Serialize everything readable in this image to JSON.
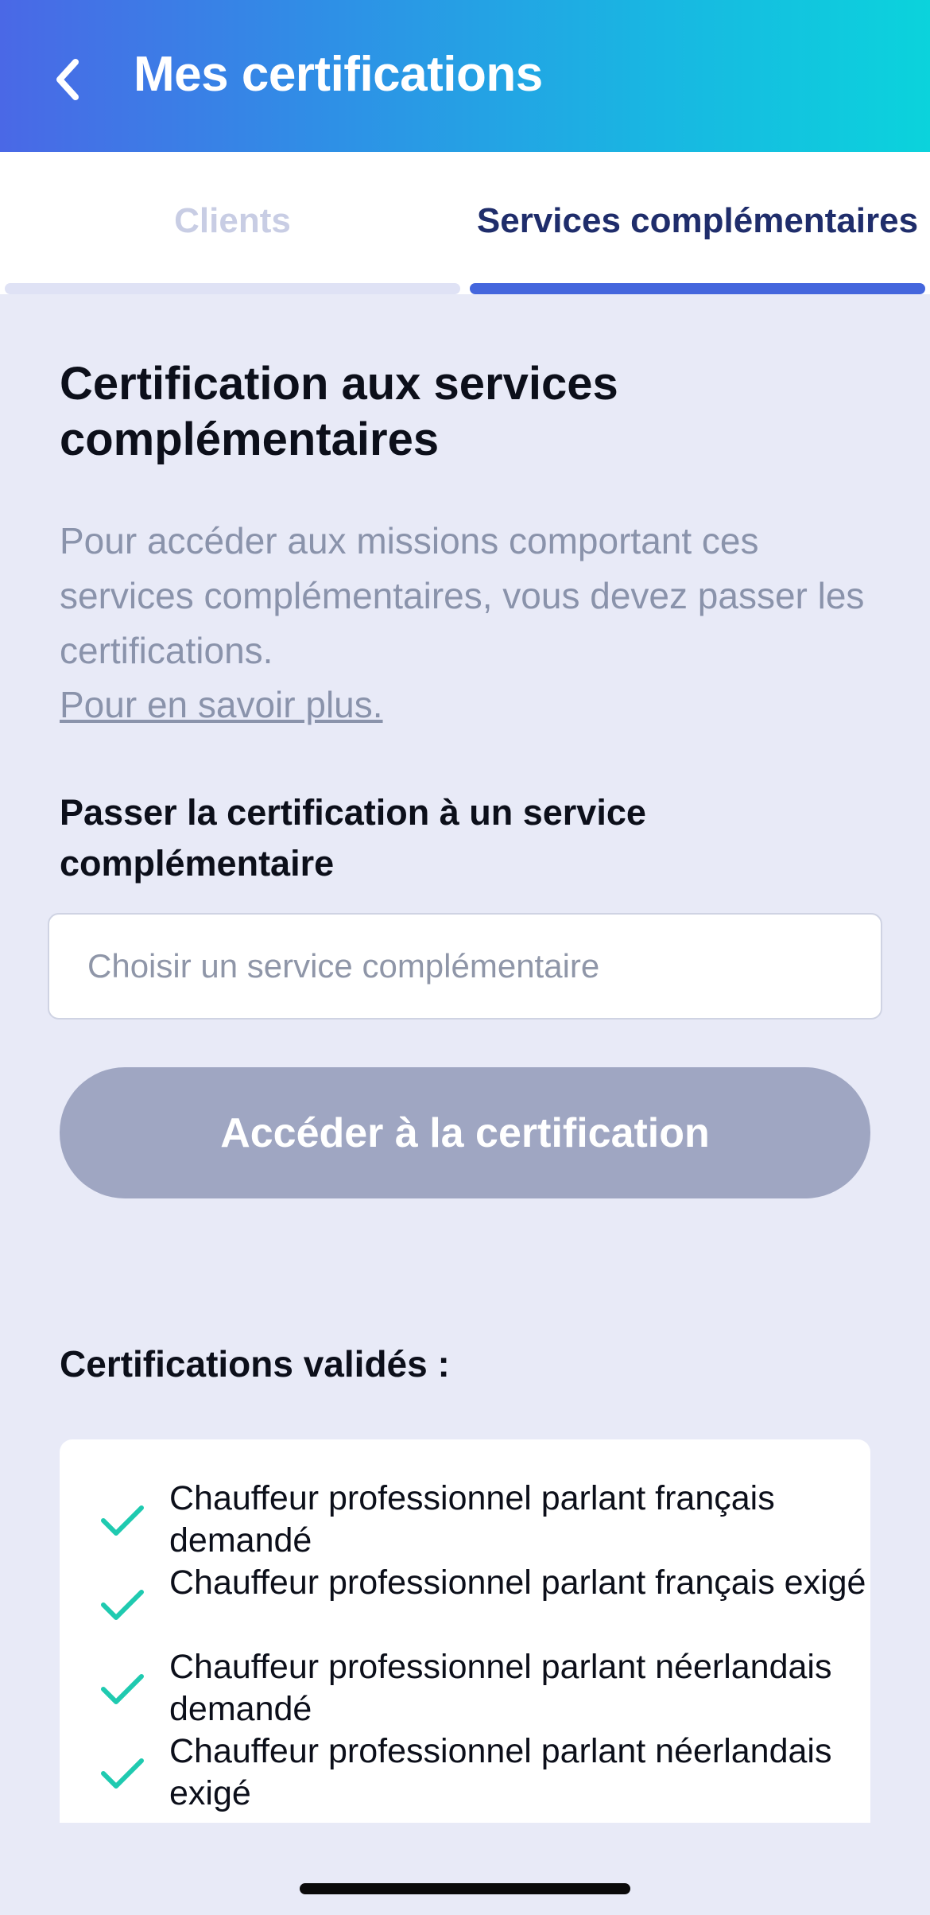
{
  "header": {
    "back_icon": "chevron-left-icon",
    "title": "Mes certifications",
    "gradient": [
      "#4a68e6",
      "#0bd3dc"
    ]
  },
  "tabs": [
    {
      "label": "Clients",
      "active": false
    },
    {
      "label": "Services complémentaires",
      "active": true
    }
  ],
  "main": {
    "title": "Certification aux services complémentaires",
    "intro": "Pour accéder aux missions comportant ces services complémentaires, vous devez passer les certifications.",
    "learn_more": "Pour en savoir plus.",
    "subtitle": "Passer la certification à un service complémentaire",
    "select_placeholder": "Choisir un service complémentaire",
    "cta_label": "Accéder à la certification",
    "cta_enabled": false
  },
  "validated": {
    "title": "Certifications validés :",
    "check_icon": "check-icon",
    "check_color": "#1fcab0",
    "items": [
      "Chauffeur professionnel parlant français demandé",
      "Chauffeur professionnel parlant français exigé",
      "Chauffeur professionnel parlant néerlandais demandé",
      "Chauffeur professionnel parlant néerlandais exigé"
    ]
  },
  "colors": {
    "accent": "#4466dd",
    "background": "#e8eaf7",
    "disabled_button": "#9fa6c2"
  }
}
